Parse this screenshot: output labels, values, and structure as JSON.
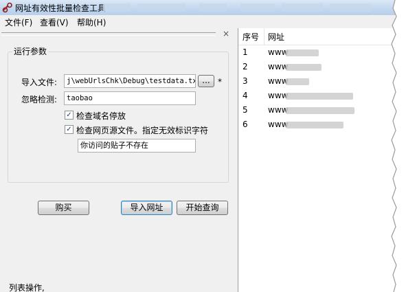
{
  "window": {
    "title": "网址有效性批量检查工具",
    "icon": "link-chain-icon"
  },
  "menu": [
    "文件(F)",
    "查看(V)",
    "帮助(H)"
  ],
  "pane": {
    "close_label": "×"
  },
  "params": {
    "group_title": "运行参数",
    "import_label": "导入文件:",
    "import_value": "j\\webUrlsChk\\Debug\\testdata.txt",
    "browse_label": "...",
    "required_mark": "*",
    "ignore_label": "忽略检测:",
    "ignore_value": "taobao",
    "check_domain_label": "检查域名停放",
    "check_domain_checked": "✓",
    "check_source_label": "检查网页源文件。指定无效标识字符",
    "check_source_checked": "✓",
    "invalid_marker_value": "你访问的贴子不存在"
  },
  "buttons": {
    "buy": "购买",
    "import_urls": "导入网址",
    "start_query": "开始查询"
  },
  "list_ops_label": "列表操作,",
  "table": {
    "headers": [
      "序号",
      "网址"
    ],
    "rows": [
      {
        "num": "1",
        "url": "www"
      },
      {
        "num": "2",
        "url": "www"
      },
      {
        "num": "3",
        "url": "www"
      },
      {
        "num": "4",
        "url": "www"
      },
      {
        "num": "5",
        "url": "www"
      },
      {
        "num": "6",
        "url": "www"
      }
    ]
  },
  "colors": {
    "titlebar": "#c5d9f0",
    "window_bg": "#f0f0f0",
    "checkmark": "#1c3c78"
  }
}
